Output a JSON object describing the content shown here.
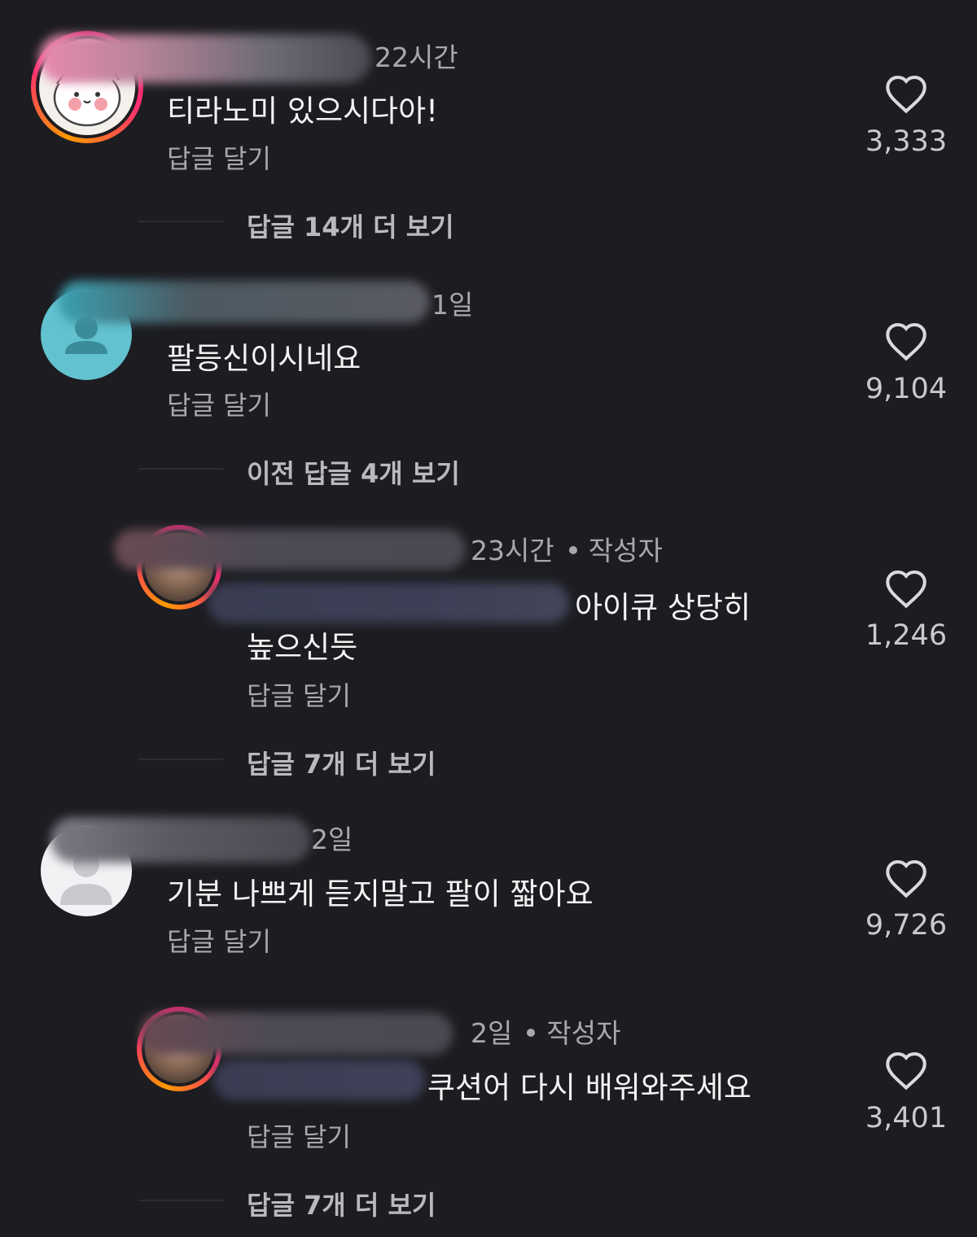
{
  "comments": [
    {
      "time": "22시간",
      "text": "티라노미 있으시다아!",
      "reply_label": "답글 달기",
      "likes": "3,333",
      "more": "답글 14개 더 보기"
    },
    {
      "time": "1일",
      "text": "팔등신이시네요",
      "reply_label": "답글 달기",
      "likes": "9,104",
      "more": "이전 답글 4개 보기"
    },
    {
      "time": "23시간",
      "author_badge": "작성자",
      "text_line1": "아이큐 상당히",
      "text_line2": "높으신듯",
      "reply_label": "답글 달기",
      "likes": "1,246",
      "more": "답글 7개 더 보기"
    },
    {
      "time": "2일",
      "text": "기분 나쁘게 듣지말고 팔이 짧아요",
      "reply_label": "답글 달기",
      "likes": "9,726"
    },
    {
      "time": "2일",
      "author_badge": "작성자",
      "text": "쿠션어 다시 배워와주세요",
      "reply_label": "답글 달기",
      "likes": "3,401",
      "more": "답글 7개 더 보기"
    }
  ],
  "icons": {
    "like": "heart-outline-icon",
    "default_avatar": "person-silhouette-icon"
  },
  "colors": {
    "background": "#1c1c21",
    "story_ring": "#ff2d6f"
  }
}
